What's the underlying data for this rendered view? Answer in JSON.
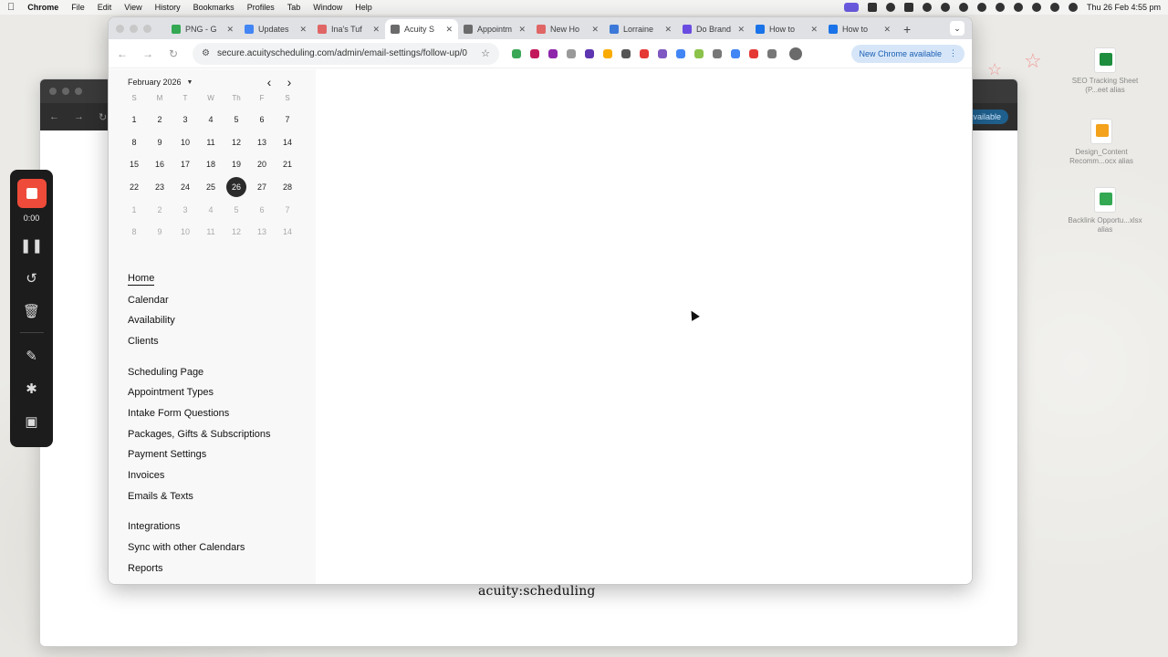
{
  "menubar": {
    "app": "Chrome",
    "items": [
      "File",
      "Edit",
      "View",
      "History",
      "Bookmarks",
      "Profiles",
      "Tab",
      "Window",
      "Help"
    ],
    "clock": "Thu 26 Feb  4:55 pm"
  },
  "recorder": {
    "time": "0:00"
  },
  "desktop_icons": [
    {
      "label": "SEO Tracking Sheet (P...eet alias",
      "color": "#1e8e3e"
    },
    {
      "label": "Design_Content Recomm...ocx alias",
      "color": "#f4a21b"
    },
    {
      "label": "Backlink Opportu...xlsx alias",
      "color": "#34a853"
    }
  ],
  "bg_window": {
    "update_label": "available",
    "logo": "acuity:scheduling"
  },
  "tabs": [
    {
      "title": "PNG - G",
      "color": "#34a853"
    },
    {
      "title": "Updates",
      "color": "#4285f4"
    },
    {
      "title": "Ina's Tuf",
      "color": "#e06666"
    },
    {
      "title": "Acuity S",
      "color": "#6b6b6b",
      "active": true
    },
    {
      "title": "Appointm",
      "color": "#6b6b6b"
    },
    {
      "title": "New Ho",
      "color": "#e06666"
    },
    {
      "title": "Lorraine",
      "color": "#3c78d8"
    },
    {
      "title": "Do Brand",
      "color": "#6a4ce0"
    },
    {
      "title": "How to",
      "color": "#1a73e8"
    },
    {
      "title": "How to",
      "color": "#1a73e8"
    }
  ],
  "toolbar": {
    "url": "secure.acuityscheduling.com/admin/email-settings/follow-up/0",
    "update_label": "New Chrome available",
    "extensions": [
      "#3aa757",
      "#c2185b",
      "#8e24aa",
      "#999999",
      "#5e35b1",
      "#f9ab00",
      "#555555",
      "#e53935",
      "#7e57c2",
      "#4285f4",
      "#8bc34a",
      "#777777",
      "#4285f4",
      "#e53935",
      "#777777"
    ]
  },
  "calendar": {
    "month": "February 2026",
    "dow": [
      "S",
      "M",
      "T",
      "W",
      "Th",
      "F",
      "S"
    ],
    "weeks": [
      [
        "1",
        "2",
        "3",
        "4",
        "5",
        "6",
        "7"
      ],
      [
        "8",
        "9",
        "10",
        "11",
        "12",
        "13",
        "14"
      ],
      [
        "15",
        "16",
        "17",
        "18",
        "19",
        "20",
        "21"
      ],
      [
        "22",
        "23",
        "24",
        "25",
        "26",
        "27",
        "28"
      ],
      [
        "1",
        "2",
        "3",
        "4",
        "5",
        "6",
        "7"
      ],
      [
        "8",
        "9",
        "10",
        "11",
        "12",
        "13",
        "14"
      ]
    ],
    "selected": "26",
    "muted_rows": [
      4,
      5
    ]
  },
  "nav": {
    "group1": [
      "Home",
      "Calendar",
      "Availability",
      "Clients"
    ],
    "group2": [
      "Scheduling Page",
      "Appointment Types",
      "Intake Form Questions",
      "Packages, Gifts & Subscriptions",
      "Payment Settings",
      "Invoices",
      "Emails & Texts"
    ],
    "group3": [
      "Integrations",
      "Sync with other Calendars",
      "Reports"
    ],
    "current": "Home"
  }
}
